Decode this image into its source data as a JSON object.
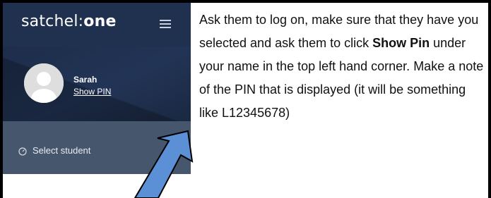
{
  "app": {
    "brand_prefix": "satchel:",
    "brand_suffix": "one",
    "menu_icon": "hamburger-menu-icon",
    "profile": {
      "name": "Sarah",
      "show_pin_label": "Show PIN",
      "avatar_icon": "user-avatar-icon"
    },
    "select_student_label": "Select student",
    "select_student_icon": "gauge-icon"
  },
  "instruction": {
    "part1": "Ask them to log on, make sure that they have you selected and ask them to click ",
    "bold": "Show Pin",
    "part2": " under your name in the top left hand corner. Make a note of the PIN that is displayed (it will be something like L12345678)"
  },
  "colors": {
    "sidebar": "#1c2a44",
    "header": "#203150",
    "select_row": "#46566d",
    "arrow_fill": "#5b8fd6",
    "frame": "#000000"
  }
}
